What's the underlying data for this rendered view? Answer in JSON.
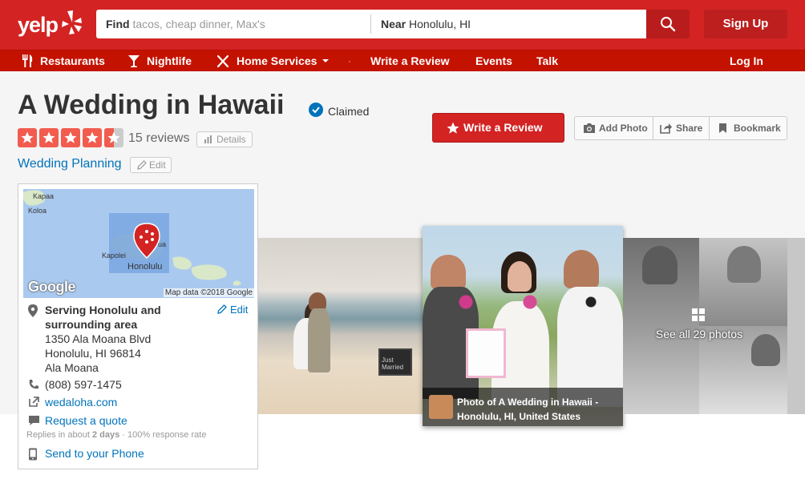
{
  "header": {
    "logo_text": "yelp",
    "find_label": "Find",
    "find_placeholder": "tacos, cheap dinner, Max's",
    "near_label": "Near",
    "near_value": "Honolulu, HI",
    "signup_label": "Sign Up"
  },
  "nav": {
    "items": [
      {
        "label": "Restaurants",
        "icon": "fork-knife-icon"
      },
      {
        "label": "Nightlife",
        "icon": "cocktail-icon"
      },
      {
        "label": "Home Services",
        "icon": "tools-icon"
      },
      {
        "label": "Write a Review"
      },
      {
        "label": "Events"
      },
      {
        "label": "Talk"
      }
    ],
    "login_label": "Log In"
  },
  "business": {
    "name": "A Wedding in Hawaii",
    "claimed_label": "Claimed",
    "rating": 4.5,
    "reviews_label": "15 reviews",
    "details_label": "Details",
    "category": "Wedding Planning",
    "edit_label": "Edit"
  },
  "actions": {
    "write_review": "Write a Review",
    "add_photo": "Add Photo",
    "share": "Share",
    "bookmark": "Bookmark"
  },
  "map": {
    "labels": [
      "Kapaa",
      "Koloa",
      "Kapolei",
      "Honolulu",
      "ua"
    ],
    "google": "Google",
    "map_data": "Map data ©2018 Google"
  },
  "info": {
    "serving_line1": "Serving Honolulu and",
    "serving_line2": "surrounding area",
    "edit_label": "Edit",
    "address1": "1350 Ala Moana Blvd",
    "address2": "Honolulu, HI 96814",
    "address3": "Ala Moana",
    "phone": "(808) 597-1475",
    "website": "wedaloha.com",
    "quote": "Request a quote",
    "replies_prefix": "Replies in about ",
    "replies_time": "2 days",
    "replies_suffix": " · 100% response rate",
    "send_phone": "Send to your Phone"
  },
  "photos": {
    "caption_line1": "Photo of A Wedding in Hawaii -",
    "caption_line2": "Honolulu, HI, United States",
    "see_all": "See all 29 photos",
    "sign_text": "Just Married"
  },
  "colors": {
    "brand_red": "#d32323",
    "nav_red": "#c41200",
    "link_blue": "#0073bb",
    "star_red": "#f15c4f"
  }
}
